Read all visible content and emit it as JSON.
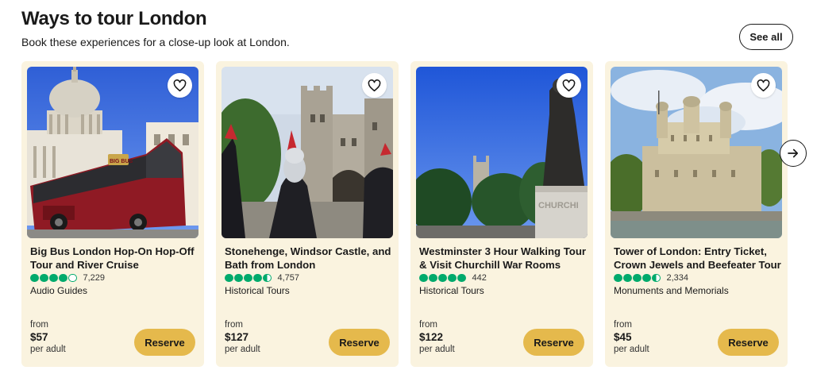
{
  "section": {
    "title": "Ways to tour London",
    "subtitle": "Book these experiences for a close-up look at London.",
    "see_all_label": "See all"
  },
  "cards": [
    {
      "title": "Big Bus London Hop-On Hop-Off Tour and River Cruise",
      "rating": 4.0,
      "review_count": "7,229",
      "category": "Audio Guides",
      "from_label": "from",
      "price": "$57",
      "per_label": "per adult",
      "reserve_label": "Reserve"
    },
    {
      "title": "Stonehenge, Windsor Castle, and Bath from London",
      "rating": 4.5,
      "review_count": "4,757",
      "category": "Historical Tours",
      "from_label": "from",
      "price": "$127",
      "per_label": "per adult",
      "reserve_label": "Reserve"
    },
    {
      "title": "Westminster 3 Hour Walking Tour & Visit Churchill War Rooms",
      "rating": 5.0,
      "review_count": "442",
      "category": "Historical Tours",
      "from_label": "from",
      "price": "$122",
      "per_label": "per adult",
      "reserve_label": "Reserve"
    },
    {
      "title": "Tower of London: Entry Ticket, Crown Jewels and Beefeater Tour",
      "rating": 4.5,
      "review_count": "2,334",
      "category": "Monuments and Memorials",
      "from_label": "from",
      "price": "$45",
      "per_label": "per adult",
      "reserve_label": "Reserve"
    }
  ],
  "image_text": {
    "bus_logo": "BIG BUS",
    "statue_plinth": "CHURCHI"
  },
  "icons": {
    "favorite": "heart-icon",
    "next": "arrow-right-icon"
  },
  "colors": {
    "card_background": "#faf3df",
    "reserve_button": "#e5b94c",
    "rating_bubble": "#00aa6c"
  }
}
